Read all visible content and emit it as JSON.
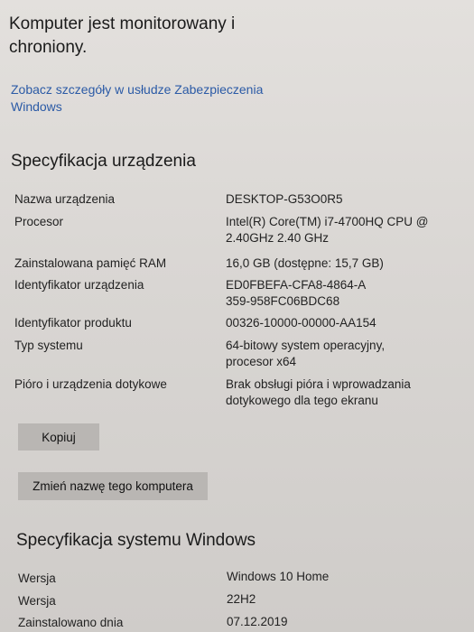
{
  "security": {
    "status_text": "Komputer jest monitorowany i chroniony.",
    "details_link": "Zobacz szczegóły w usłudze Zabezpieczenia Windows"
  },
  "device_spec": {
    "title": "Specyfikacja urządzenia",
    "rows": [
      {
        "label": "Nazwa urządzenia",
        "value": "DESKTOP-G53O0R5"
      },
      {
        "label": "Procesor",
        "value": "Intel(R) Core(TM) i7-4700HQ CPU @ 2.40GHz   2.40 GHz"
      },
      {
        "label": "Zainstalowana pamięć RAM",
        "value": "16,0 GB (dostępne: 15,7 GB)"
      },
      {
        "label": "Identyfikator urządzenia",
        "value": "ED0FBEFA-CFA8-4864-A359-958FC06BDC68"
      },
      {
        "label": "Identyfikator produktu",
        "value": "00326-10000-00000-AA154"
      },
      {
        "label": "Typ systemu",
        "value": "64-bitowy system operacyjny, procesor x64"
      },
      {
        "label": "Pióro i urządzenia dotykowe",
        "value": "Brak obsługi pióra i wprowadzania dotykowego dla tego ekranu"
      }
    ],
    "copy_button": "Kopiuj",
    "rename_button": "Zmień nazwę tego komputera"
  },
  "windows_spec": {
    "title": "Specyfikacja systemu Windows",
    "rows": [
      {
        "label": "Wersja",
        "value": "Windows 10 Home"
      },
      {
        "label": "Wersja",
        "value": "22H2"
      },
      {
        "label": "Zainstalowano dnia",
        "value": "07.12.2019"
      }
    ]
  }
}
